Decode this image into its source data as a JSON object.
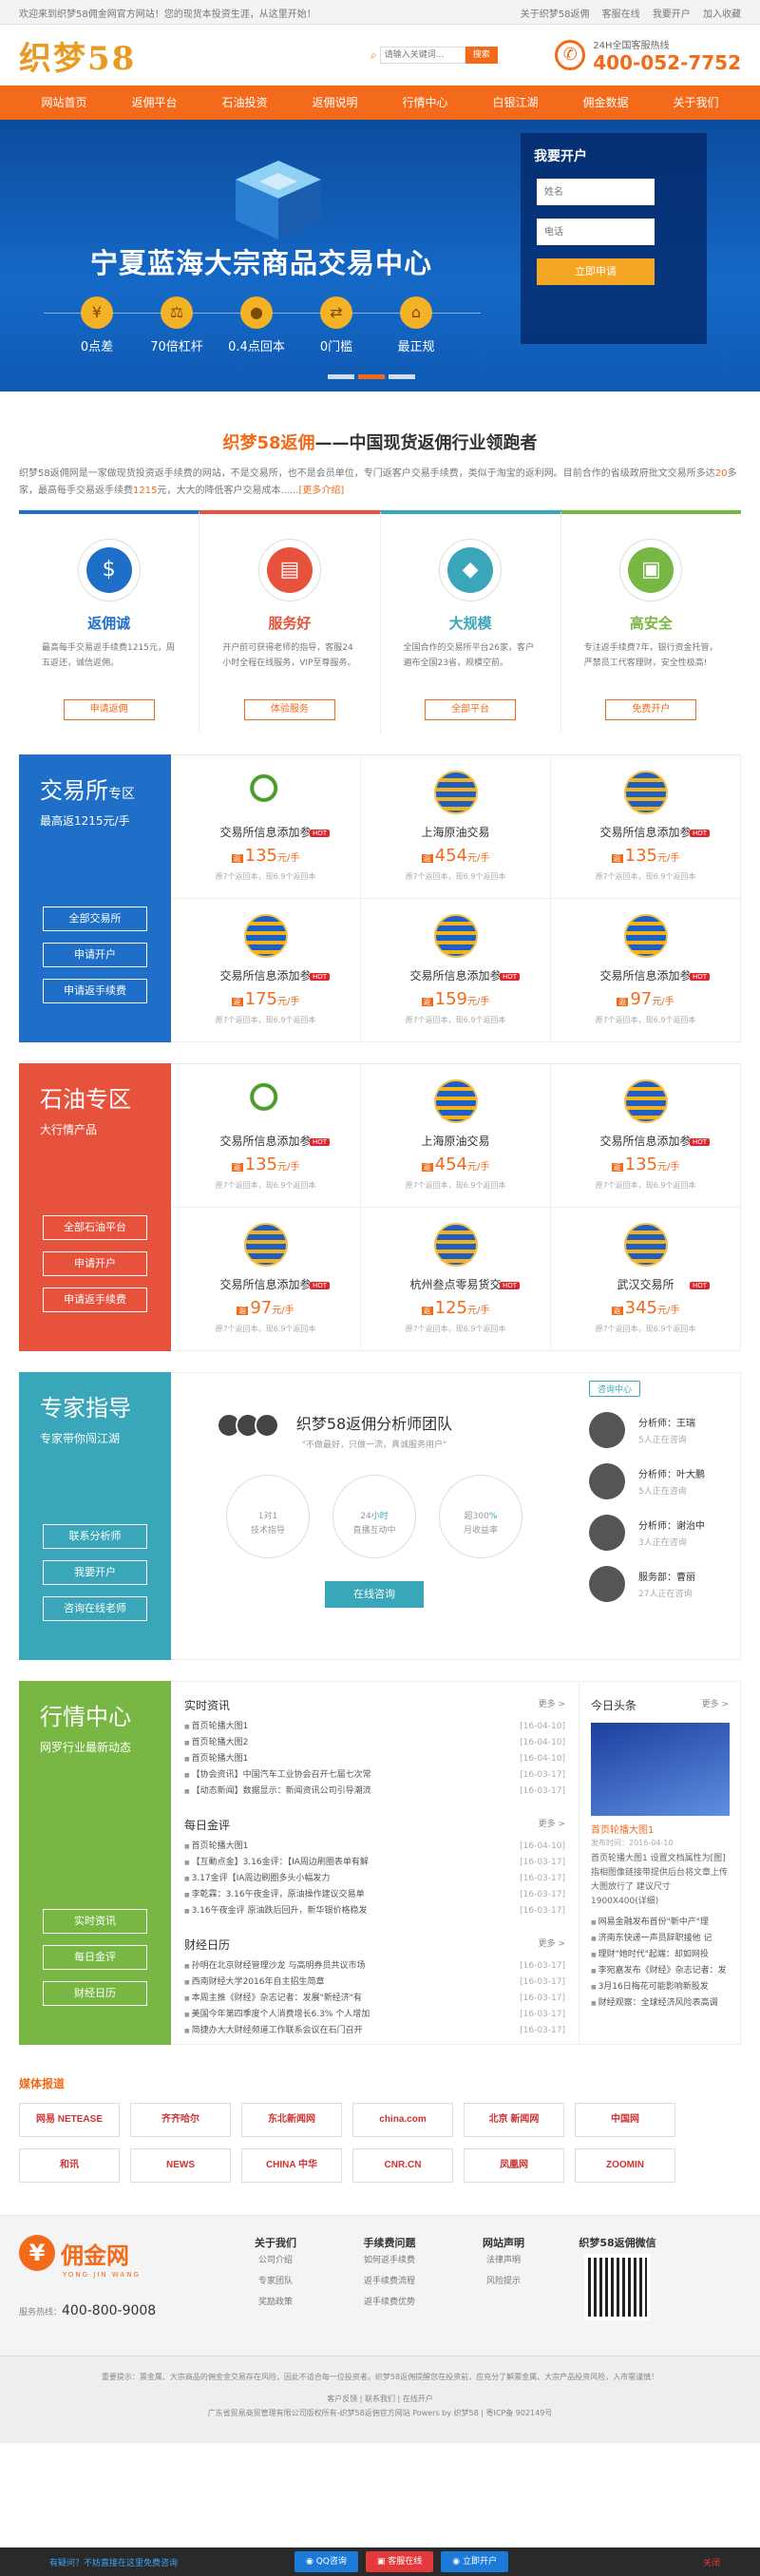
{
  "topbar": {
    "welcome": "欢迎来到织梦58佣金网官方网站！您的现货本投资生涯，从这里开始！",
    "links": [
      "关于织梦58返佣",
      "客服在线",
      "我要开户",
      "加入收藏"
    ]
  },
  "header": {
    "logo": "织梦58",
    "search_placeholder": "请输入关键词...",
    "search_btn": "搜索",
    "hot_label": "24H全国客服热线",
    "hot_number": "400-052-7752"
  },
  "nav": [
    "网站首页",
    "返佣平台",
    "石油投资",
    "返佣说明",
    "行情中心",
    "白银江湖",
    "佣金数据",
    "关于我们"
  ],
  "banner": {
    "title": "宁夏蓝海大宗商品交易中心",
    "features": [
      {
        "icon": "coin-icon",
        "glyph": "¥",
        "label": "0点差"
      },
      {
        "icon": "scale-icon",
        "glyph": "⚖",
        "label": "70倍杠杆"
      },
      {
        "icon": "piggy-icon",
        "glyph": "●",
        "label": "0.4点回本"
      },
      {
        "icon": "shuffle-icon",
        "glyph": "⇄",
        "label": "0门槛"
      },
      {
        "icon": "house-icon",
        "glyph": "⌂",
        "label": "最正规"
      }
    ],
    "form": {
      "title": "我要开户",
      "name_ph": "姓名",
      "phone_ph": "电话",
      "submit": "立即申请"
    }
  },
  "intro": {
    "brand": "织梦58返佣",
    "title_rest": "——中国现货返佣行业领跑者",
    "p1": "织梦58返佣网是一家做现货投资返手续费的网站，不是交易所，也不是会员单位，专门返客户交易手续费，类似于淘宝的返利网。目前合作的省级政府批文交易所多达",
    "num1": "20",
    "p2": "多家，最高每手交易返手续费",
    "num2": "1215",
    "p3": "元，大大的降低客户交易成本......",
    "more": "[更多介绍]"
  },
  "features": [
    {
      "title": "返佣诚",
      "color": "#1f6fc8",
      "glyph": "$",
      "desc": "最高每手交易返手续费1215元，周五返还，诚信返佣。",
      "btn": "申请返佣"
    },
    {
      "title": "服务好",
      "color": "#e6523b",
      "glyph": "▤",
      "desc": "开户前可获得老师的指导，客服24小时全程在线服务，VIP至尊服务。",
      "btn": "体验服务"
    },
    {
      "title": "大规模",
      "color": "#3aa6b9",
      "glyph": "◆",
      "desc": "全国合作的交易所平台26家，客户遍布全国23省，规模空前。",
      "btn": "全部平台"
    },
    {
      "title": "高安全",
      "color": "#78b743",
      "glyph": "▣",
      "desc": "专注返手续费7年，银行资金托管，严禁员工代客理财，安全性极高!",
      "btn": "免费开户"
    }
  ],
  "exchange": {
    "title": "交易所",
    "title_small": "专区",
    "sub": "最高返1215元/手",
    "color": "#1f6fc8",
    "btns": [
      "全部交易所",
      "申请开户",
      "申请返手续费"
    ],
    "items": [
      {
        "name": "交易所信息添加参",
        "price": "135",
        "hot": "HOT",
        "foot": "原7个返回本，现6.9个返回本",
        "img": "lens"
      },
      {
        "name": "上海原油交易",
        "price": "454",
        "hot": "",
        "foot": "原7个返回本，现6.9个返回本",
        "img": "globe"
      },
      {
        "name": "交易所信息添加参",
        "price": "135",
        "hot": "HOT",
        "foot": "原7个返回本，现6.9个返回本",
        "img": "globe"
      },
      {
        "name": "交易所信息添加参",
        "price": "175",
        "hot": "HOT",
        "foot": "原7个返回本，现6.9个返回本",
        "img": "globe"
      },
      {
        "name": "交易所信息添加参",
        "price": "159",
        "hot": "HOT",
        "foot": "原7个返回本，现6.9个返回本",
        "img": "globe"
      },
      {
        "name": "交易所信息添加参",
        "price": "97",
        "hot": "HOT",
        "foot": "原7个返回本，现6.9个返回本",
        "img": "globe"
      }
    ]
  },
  "oil": {
    "title": "石油专区",
    "title_small": "",
    "sub": "大行情产品",
    "color": "#e6523b",
    "btns": [
      "全部石油平台",
      "申请开户",
      "申请返手续费"
    ],
    "items": [
      {
        "name": "交易所信息添加参",
        "price": "135",
        "hot": "HOT",
        "foot": "原7个返回本，现6.9个返回本",
        "img": "lens"
      },
      {
        "name": "上海原油交易",
        "price": "454",
        "hot": "",
        "foot": "原7个返回本，现6.9个返回本",
        "img": "globe"
      },
      {
        "name": "交易所信息添加参",
        "price": "135",
        "hot": "HOT",
        "foot": "原7个返回本，现6.9个返回本",
        "img": "globe"
      },
      {
        "name": "交易所信息添加参",
        "price": "97",
        "hot": "HOT",
        "foot": "原7个返回本，现6.9个返回本",
        "img": "globe"
      },
      {
        "name": "杭州叁点零易货交",
        "price": "125",
        "hot": "HOT",
        "foot": "原7个返回本，现6.9个返回本",
        "img": "globe"
      },
      {
        "name": "武汉交易所",
        "price": "345",
        "hot": "HOT",
        "foot": "原7个返回本，现6.9个返回本",
        "img": "globe"
      }
    ]
  },
  "expert": {
    "title": "专家指导",
    "sub": "专家带你闯江湖",
    "color": "#3aa6b9",
    "btns": [
      "联系分析师",
      "我要开户",
      "咨询在线老师"
    ],
    "team": "织梦58返佣分析师团队",
    "team_sub": "\"不做最好，只做一流，真诚服务用户\"",
    "stats": [
      {
        "big": "1对1",
        "unit": "",
        "label": "技术指导"
      },
      {
        "big": "24",
        "unit": "小时",
        "label": "直播互动中"
      },
      {
        "big": "超300",
        "unit": "%",
        "label": "月收益率"
      }
    ],
    "consult": "在线咨询",
    "tab": "咨询中心",
    "analysts": [
      {
        "name": "分析师：王瑞",
        "status": "5人正在咨询"
      },
      {
        "name": "分析师：叶大鹏",
        "status": "5人正在咨询"
      },
      {
        "name": "分析师：谢治中",
        "status": "3人正在咨询"
      },
      {
        "name": "服务部：曹丽",
        "status": "27人正在咨询"
      }
    ]
  },
  "market": {
    "title": "行情中心",
    "sub": "网罗行业最新动态",
    "color": "#78b743",
    "btns": [
      "实时资讯",
      "每日金评",
      "财经日历"
    ],
    "more": "更多 >",
    "cols": [
      {
        "head": "实时资讯",
        "list": [
          {
            "t": "首页轮播大图1",
            "d": "[16-04-10]"
          },
          {
            "t": "首页轮播大图2",
            "d": "[16-04-10]"
          },
          {
            "t": "首页轮播大图1",
            "d": "[16-04-10]"
          },
          {
            "t": "【协会资讯】中国汽车工业协会召开七届七次常",
            "d": "[16-03-17]"
          },
          {
            "t": "【动态新闻】数据显示：新闻资讯公司引导潮流",
            "d": "[16-03-17]"
          }
        ]
      },
      {
        "head": "每日金评",
        "list": [
          {
            "t": "首页轮播大图1",
            "d": "[16-04-10]"
          },
          {
            "t": "【互動点金】3.16金评：【IA周边刷圈表单有解",
            "d": "[16-03-17]"
          },
          {
            "t": "3.17金评【IA周边刷圈多头小幅发力",
            "d": "[16-03-17]"
          },
          {
            "t": "李乾霖：3.16午夜金评，原油操作建议交易单",
            "d": "[16-03-17]"
          },
          {
            "t": "3.16午夜金评 原油跌后回升，新华银价格稳发",
            "d": "[16-03-17]"
          }
        ]
      },
      {
        "head": "财经日历",
        "list": [
          {
            "t": "孙明在北京财经管理沙龙 与高明券员共议市场",
            "d": "[16-03-17]"
          },
          {
            "t": "西南财经大学2016年自主招生简章",
            "d": "[16-03-17]"
          },
          {
            "t": "本周主推《财经》杂志记者：发展\"新经济\"有",
            "d": "[16-03-17]"
          },
          {
            "t": "美国今年第四季度个人消费增长6.3% 个人增加",
            "d": "[16-03-17]"
          },
          {
            "t": "简捷办大大财经频道工作联系会议在石门召开",
            "d": "[16-03-17]"
          }
        ]
      }
    ],
    "headline": {
      "head": "今日头条",
      "title": "首页轮播大图1",
      "date": "发布时间：2016-04-10",
      "desc": "首页轮播大图1 设置文档属性为[图] 指相图像链接带提供后台将文章上传大图放行了 建议尺寸 1900X400(详细)",
      "list": [
        "网易金融发布首份\"新中产\"理",
        "济南东快递一声员辞职接他 记",
        "理财\"她时代\"起端：却如网投",
        "李宛嘉发布《财经》杂志记者：发",
        "3月16日梅花可能影响新股发",
        "财经观察：全球经济风险表高调"
      ]
    }
  },
  "media": {
    "title": "媒体报道",
    "logos": [
      "网易 NETEASE",
      "齐齐哈尔",
      "东北新闻网",
      "china.com",
      "北京 新闻网",
      "中国网",
      "和讯",
      "NEWS",
      "CHINA 中华",
      "CNR.CN",
      "凤凰网",
      "ZOOMIN"
    ]
  },
  "footer": {
    "brand": "佣金网",
    "brand_en": "YONG JIN WANG",
    "tel_label": "服务热线：",
    "tel": "400-800-9008",
    "cols": [
      {
        "h": "关于我们",
        "items": [
          "公司介绍",
          "专家团队",
          "奖励政策"
        ]
      },
      {
        "h": "手续费问题",
        "items": [
          "如何返手续费",
          "返手续费流程",
          "返手续费优势"
        ]
      },
      {
        "h": "网站声明",
        "items": [
          "法律声明",
          "风险提示"
        ]
      }
    ],
    "qr_title": "织梦58返佣微信"
  },
  "bottom": {
    "l1": "重要提示：票金属、大宗商品的佣金金交易存在风险，因此不适合每一位投资者。织梦58返佣提醒您在投资前，应充分了解票金属、大宗产品投资风险，入市需谨慎！",
    "l2": "客户反馈 | 联系我们 | 在线开户",
    "l3": "广东省贸易商贸管理有限公司版权所有-织梦58返佣官方网站 Powers by 织梦58 | 粤ICP备 902149号"
  },
  "fixbar": {
    "tip": "有疑问？不妨直接在这里免费咨询",
    "qq": "QQ咨询",
    "online": "客服在线",
    "open": "立即开户",
    "close": "关闭"
  }
}
